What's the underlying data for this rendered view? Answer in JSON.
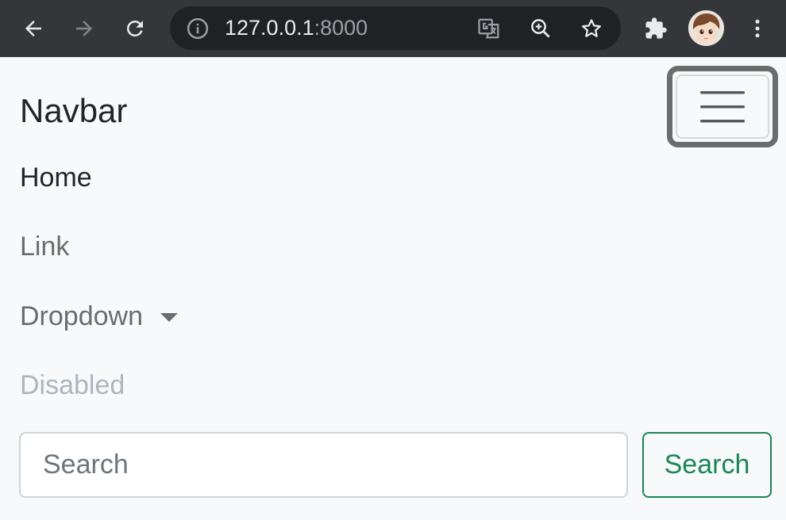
{
  "browser": {
    "url_host": "127.0.0.1",
    "url_port": ":8000",
    "icons": {
      "back": "back-arrow-icon",
      "forward": "forward-arrow-icon",
      "reload": "reload-icon",
      "info": "info-icon",
      "translate": "translate-icon",
      "zoom": "zoom-in-icon",
      "bookmark": "star-icon",
      "extensions": "puzzle-icon",
      "profile": "avatar",
      "menu": "kebab-menu-icon"
    },
    "colors": {
      "toolbar": "#35363a",
      "omnibox": "#202124"
    }
  },
  "navbar": {
    "brand": "Navbar",
    "items": [
      {
        "label": "Home",
        "state": "active"
      },
      {
        "label": "Link",
        "state": "normal"
      },
      {
        "label": "Dropdown",
        "state": "dropdown"
      },
      {
        "label": "Disabled",
        "state": "disabled"
      }
    ],
    "search": {
      "placeholder": "Search",
      "button_label": "Search"
    },
    "toggler_icon": "hamburger-icon",
    "colors": {
      "success": "#198754",
      "muted": "#6c6c6c",
      "disabled": "#adb5bd",
      "background": "#f8f9fa"
    }
  }
}
